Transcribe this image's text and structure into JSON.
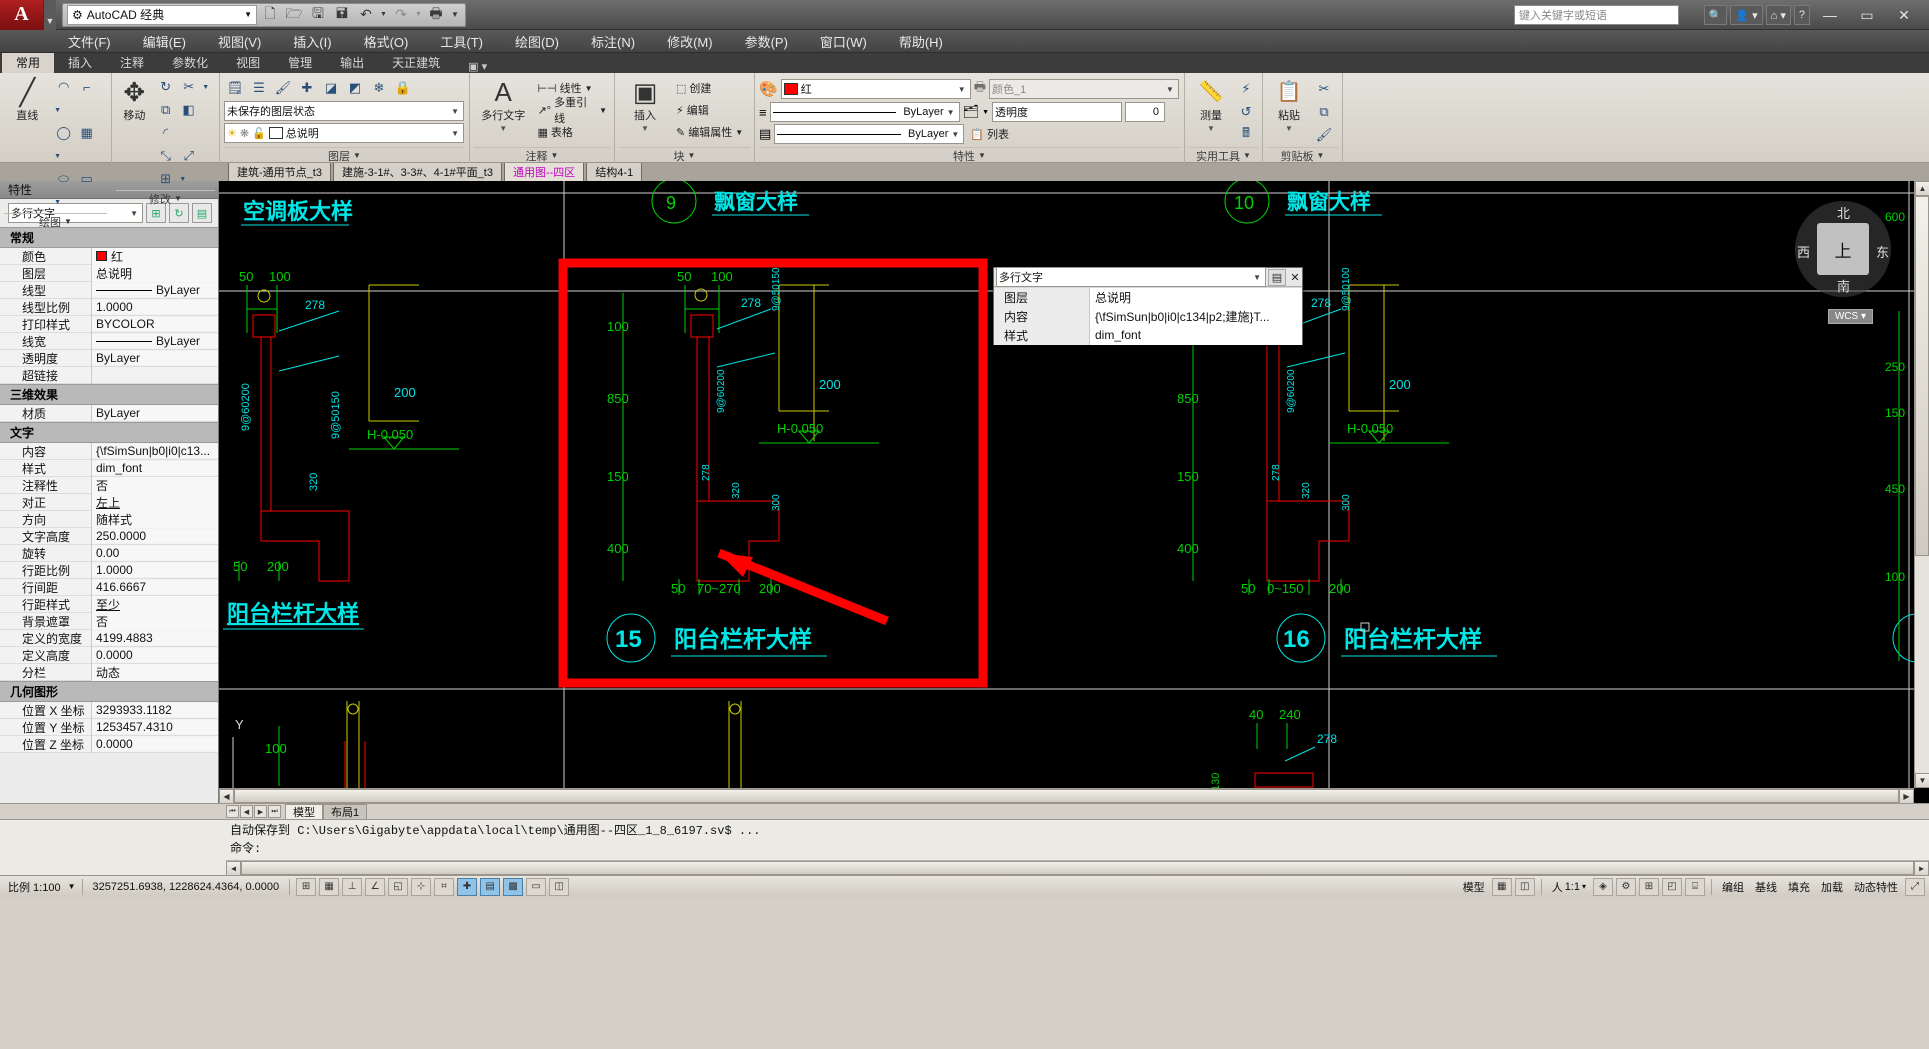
{
  "titlebar": {
    "logo_text": "A",
    "workspace": "AutoCAD 经典",
    "gear_icon": "gear-icon",
    "quick_access": [
      {
        "name": "new",
        "glyph": "🗋"
      },
      {
        "name": "open",
        "glyph": "🗀"
      },
      {
        "name": "save",
        "glyph": "🖫"
      },
      {
        "name": "save-as",
        "glyph": "🖬"
      },
      {
        "name": "undo",
        "glyph": "↶"
      },
      {
        "name": "redo",
        "glyph": "↷"
      },
      {
        "name": "plot",
        "glyph": "🖶"
      }
    ],
    "search_placeholder": "键入关键字或短语",
    "window_buttons": [
      "—",
      "▭",
      "✕"
    ]
  },
  "menubar": [
    "文件(F)",
    "编辑(E)",
    "视图(V)",
    "插入(I)",
    "格式(O)",
    "工具(T)",
    "绘图(D)",
    "标注(N)",
    "修改(M)",
    "参数(P)",
    "窗口(W)",
    "帮助(H)"
  ],
  "ribbon_tabs": [
    {
      "label": "常用",
      "active": true
    },
    {
      "label": "插入",
      "active": false
    },
    {
      "label": "注释",
      "active": false
    },
    {
      "label": "参数化",
      "active": false
    },
    {
      "label": "视图",
      "active": false
    },
    {
      "label": "管理",
      "active": false
    },
    {
      "label": "输出",
      "active": false
    },
    {
      "label": "天正建筑",
      "active": false
    }
  ],
  "ribbon_panels": {
    "draw": {
      "title": "绘图",
      "big_label": "直线",
      "big_glyph": "╱"
    },
    "modify": {
      "title": "修改",
      "big_label": "移动",
      "big_glyph": "✥"
    },
    "layer": {
      "title": "图层",
      "state_combo": "未保存的图层状态",
      "layer_combo": "总说明"
    },
    "annotation": {
      "title": "注释",
      "big_label": "多行文字",
      "big_glyph": "A",
      "items": [
        {
          "label": "线性",
          "icon": "linear-dim-icon"
        },
        {
          "label": "多重引线",
          "icon": "multileader-icon"
        },
        {
          "label": "表格",
          "icon": "table-icon"
        }
      ]
    },
    "block": {
      "title": "块",
      "big_label": "插入",
      "items": [
        {
          "label": "创建",
          "icon": "create-block-icon"
        },
        {
          "label": "编辑",
          "icon": "edit-block-icon"
        },
        {
          "label": "编辑属性",
          "icon": "edit-attribute-icon"
        }
      ]
    },
    "properties": {
      "title": "特性",
      "color": "红",
      "color_hex": "#ff0000",
      "linetype": "ByLayer",
      "lineweight": "ByLayer",
      "plotstyle": "颜色_1",
      "transparency_label": "透明度",
      "transparency_value": "0",
      "list_label": "列表"
    },
    "utilities": {
      "title": "实用工具",
      "big_label": "测量"
    },
    "clipboard": {
      "title": "剪贴板",
      "big_label": "粘贴"
    }
  },
  "file_tabs": [
    {
      "label": "建筑-通用节点_t3",
      "active": false
    },
    {
      "label": "建施-3-1#、3-3#、4-1#平面_t3",
      "active": false
    },
    {
      "label": "通用图--四区",
      "active": true
    },
    {
      "label": "结构4-1",
      "active": false
    }
  ],
  "properties_palette": {
    "title": "特性",
    "object_type": "多行文字",
    "toolbar_icons": [
      "pick-point-icon",
      "quick-select-icon",
      "toggle-icon"
    ],
    "sections": [
      {
        "name": "常规",
        "rows": [
          {
            "key": "颜色",
            "value": "红",
            "swatch": "#ff0000"
          },
          {
            "key": "图层",
            "value": "总说明"
          },
          {
            "key": "线型",
            "value": "ByLayer",
            "line": true
          },
          {
            "key": "线型比例",
            "value": "1.0000"
          },
          {
            "key": "打印样式",
            "value": "BYCOLOR"
          },
          {
            "key": "线宽",
            "value": "ByLayer",
            "line": true
          },
          {
            "key": "透明度",
            "value": "ByLayer"
          },
          {
            "key": "超链接",
            "value": ""
          }
        ]
      },
      {
        "name": "三维效果",
        "rows": [
          {
            "key": "材质",
            "value": "ByLayer"
          }
        ]
      },
      {
        "name": "文字",
        "rows": [
          {
            "key": "内容",
            "value": "{\\fSimSun|b0|i0|c13..."
          },
          {
            "key": "样式",
            "value": "dim_font"
          },
          {
            "key": "注释性",
            "value": "否"
          },
          {
            "key": "对正",
            "value": "左上",
            "underline": true
          },
          {
            "key": "方向",
            "value": "随样式"
          },
          {
            "key": "文字高度",
            "value": "250.0000"
          },
          {
            "key": "旋转",
            "value": "0.00"
          },
          {
            "key": "行距比例",
            "value": "1.0000"
          },
          {
            "key": "行间距",
            "value": "416.6667"
          },
          {
            "key": "行距样式",
            "value": "至少",
            "underline": true
          },
          {
            "key": "背景遮罩",
            "value": "否"
          },
          {
            "key": "定义的宽度",
            "value": "4199.4883"
          },
          {
            "key": "定义高度",
            "value": "0.0000"
          },
          {
            "key": "分栏",
            "value": "动态"
          }
        ]
      },
      {
        "name": "几何图形",
        "rows": [
          {
            "key": "位置 X 坐标",
            "value": "3293933.1182"
          },
          {
            "key": "位置 Y 坐标",
            "value": "1253457.4310"
          },
          {
            "key": "位置 Z 坐标",
            "value": "0.0000"
          }
        ]
      }
    ]
  },
  "quick_properties": {
    "object_type": "多行文字",
    "close_glyph": "✕",
    "rows": [
      {
        "key": "图层",
        "value": "总说明"
      },
      {
        "key": "内容",
        "value": "{\\fSimSun|b0|i0|c134|p2;建施}T..."
      },
      {
        "key": "样式",
        "value": "dim_font"
      }
    ]
  },
  "drawing": {
    "details": [
      {
        "number": "15",
        "title": "阳台栏杆大样",
        "highlighted": true
      },
      {
        "number": "16",
        "title": "阳台栏杆大样",
        "highlighted": false
      },
      {
        "number": "",
        "title": "阳台栏杆大样",
        "highlighted": false
      },
      {
        "number": "",
        "title": "空调板大样",
        "highlighted": false
      }
    ],
    "top_titles": [
      "空调板大样",
      "飘窗大样",
      "飘窗大样"
    ],
    "top_numbers": [
      "9",
      "10"
    ],
    "dims_left": [
      "50",
      "100",
      "100",
      "850",
      "150",
      "400",
      "50",
      "200"
    ],
    "dims_center": [
      "50",
      "100",
      "100",
      "850",
      "150",
      "400",
      "50",
      "70~270",
      "200",
      "278",
      "320",
      "300",
      "9@60200",
      "9@50150"
    ],
    "elevation_label": "H-0.050",
    "dim_278": "278",
    "dim_200": "200",
    "right_ruler": [
      "600",
      "250",
      "150",
      "450",
      "100"
    ],
    "bottom_dims": [
      "100",
      "100",
      "40",
      "240",
      "278",
      "130"
    ]
  },
  "viewcube": {
    "center": "上",
    "north": "北",
    "south": "南",
    "east": "东",
    "west": "西",
    "wcs": "WCS ▾"
  },
  "layout_tabs": {
    "nav": [
      "⏮",
      "◀",
      "▶",
      "⏭"
    ],
    "tabs": [
      {
        "label": "模型",
        "active": true
      },
      {
        "label": "布局1",
        "active": false
      }
    ]
  },
  "command_line": {
    "lines": [
      "自动保存到 C:\\Users\\Gigabyte\\appdata\\local\\temp\\通用图--四区_1_8_6197.sv$ ...",
      "命令:",
      "命令:"
    ]
  },
  "status_bar": {
    "scale_label": "比例 1:100",
    "coords": "3257251.6938, 1228624.4364, 0.0000",
    "left_toggles": [
      "⊞",
      "⊡",
      "∠",
      "⌗",
      "⊥",
      "◱",
      "▦",
      "▩",
      "⊕",
      "✥",
      "＋",
      "▭",
      "◫"
    ],
    "right_items": [
      "模型",
      "▦",
      "◫",
      "☀",
      "人 1:1 ▾",
      "◈",
      "⚙",
      "⊞",
      "◰",
      "⌸"
    ],
    "right_labels": [
      "编组",
      "基线",
      "填充",
      "加载",
      "动态特性"
    ],
    "annotation_scale": "1:1",
    "model_label": "模型"
  }
}
